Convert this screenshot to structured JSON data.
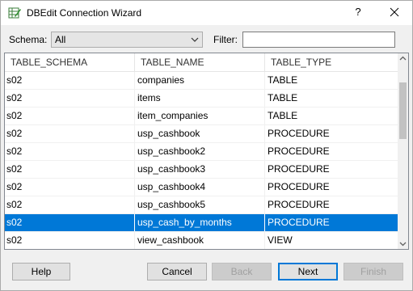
{
  "window": {
    "title": "DBEdit Connection Wizard",
    "help_glyph": "?"
  },
  "toolbar": {
    "schema_label": "Schema:",
    "schema_value": "All",
    "filter_label": "Filter:",
    "filter_value": ""
  },
  "grid": {
    "columns": [
      "TABLE_SCHEMA",
      "TABLE_NAME",
      "TABLE_TYPE"
    ],
    "rows": [
      {
        "schema": "s02",
        "name": "companies",
        "type": "TABLE"
      },
      {
        "schema": "s02",
        "name": "items",
        "type": "TABLE"
      },
      {
        "schema": "s02",
        "name": "item_companies",
        "type": "TABLE"
      },
      {
        "schema": "s02",
        "name": "usp_cashbook",
        "type": "PROCEDURE"
      },
      {
        "schema": "s02",
        "name": "usp_cashbook2",
        "type": "PROCEDURE"
      },
      {
        "schema": "s02",
        "name": "usp_cashbook3",
        "type": "PROCEDURE"
      },
      {
        "schema": "s02",
        "name": "usp_cashbook4",
        "type": "PROCEDURE"
      },
      {
        "schema": "s02",
        "name": "usp_cashbook5",
        "type": "PROCEDURE"
      },
      {
        "schema": "s02",
        "name": "usp_cash_by_months",
        "type": "PROCEDURE"
      },
      {
        "schema": "s02",
        "name": "view_cashbook",
        "type": "VIEW"
      }
    ],
    "selected_row": "usp_cash_by_months"
  },
  "buttons": {
    "help": "Help",
    "cancel": "Cancel",
    "back": "Back",
    "next": "Next",
    "finish": "Finish"
  },
  "colors": {
    "selection": "#0078d7",
    "default_button_border": "#0078d7"
  }
}
